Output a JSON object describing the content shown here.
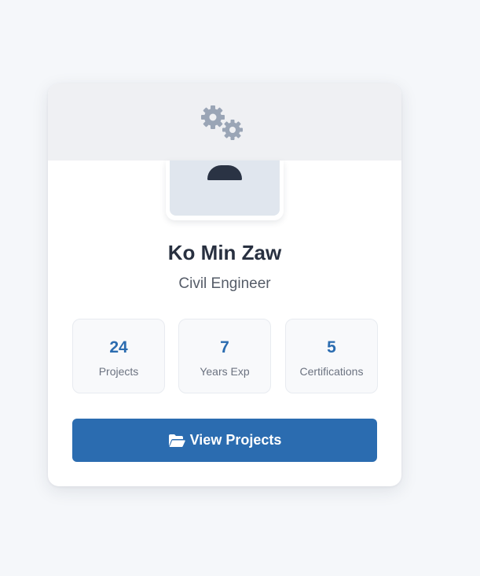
{
  "profile": {
    "name": "Ko Min Zaw",
    "role": "Civil Engineer",
    "banner_icon": "gears-icon",
    "avatar_icon": "user-silhouette-icon"
  },
  "stats": [
    {
      "value": "24",
      "label": "Projects"
    },
    {
      "value": "7",
      "label": "Years Exp"
    },
    {
      "value": "5",
      "label": "Certifications"
    }
  ],
  "actions": {
    "view_projects_label": "View Projects",
    "view_projects_icon": "folder-open-icon"
  },
  "colors": {
    "accent": "#2b6cb0",
    "page_background": "#f5f7fa",
    "banner": "#eff0f3",
    "name_text": "#283040"
  }
}
